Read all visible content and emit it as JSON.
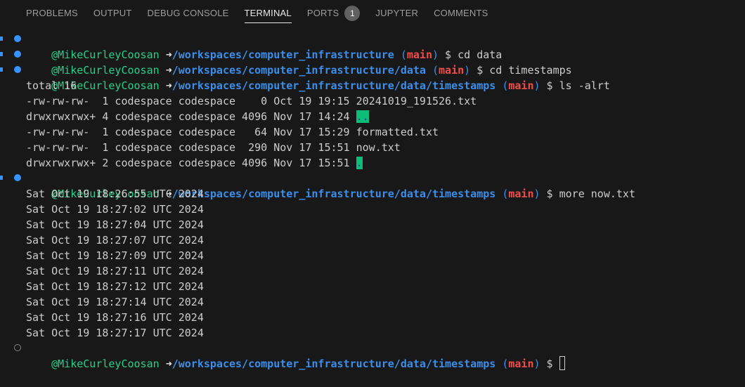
{
  "panel": {
    "tabs": [
      {
        "label": "PROBLEMS"
      },
      {
        "label": "OUTPUT"
      },
      {
        "label": "DEBUG CONSOLE"
      },
      {
        "label": "TERMINAL"
      },
      {
        "label": "PORTS",
        "badge": "1"
      },
      {
        "label": "JUPYTER"
      },
      {
        "label": "COMMENTS"
      }
    ],
    "active_tab": "TERMINAL"
  },
  "terminal": {
    "user": "@MikeCurleyCoosan",
    "arrow": "➜",
    "branch": "main",
    "prompts": [
      {
        "path": "/workspaces/computer_infrastructure",
        "command": "cd data"
      },
      {
        "path": "/workspaces/computer_infrastructure/data",
        "command": "cd timestamps"
      },
      {
        "path": "/workspaces/computer_infrastructure/data/timestamps",
        "command": "ls -alrt"
      },
      {
        "path": "/workspaces/computer_infrastructure/data/timestamps",
        "command": "more now.txt"
      },
      {
        "path": "/workspaces/computer_infrastructure/data/timestamps",
        "command": ""
      }
    ],
    "ls_output": {
      "total": "total 16",
      "rows": [
        {
          "meta": "-rw-rw-rw-  1 codespace codespace    0 Oct 19 19:15",
          "name": "20241019_191526.txt",
          "dir": false
        },
        {
          "meta": "drwxrwxrwx+ 4 codespace codespace 4096 Nov 17 14:24",
          "name": "..",
          "dir": true
        },
        {
          "meta": "-rw-rw-rw-  1 codespace codespace   64 Nov 17 15:29",
          "name": "formatted.txt",
          "dir": false
        },
        {
          "meta": "-rw-rw-rw-  1 codespace codespace  290 Nov 17 15:51",
          "name": "now.txt",
          "dir": false
        },
        {
          "meta": "drwxrwxrwx+ 2 codespace codespace 4096 Nov 17 15:51",
          "name": ".",
          "dir": true
        }
      ]
    },
    "more_output": [
      "Sat Oct 19 18:26:55 UTC 2024",
      "Sat Oct 19 18:27:02 UTC 2024",
      "Sat Oct 19 18:27:04 UTC 2024",
      "Sat Oct 19 18:27:07 UTC 2024",
      "Sat Oct 19 18:27:09 UTC 2024",
      "Sat Oct 19 18:27:11 UTC 2024",
      "Sat Oct 19 18:27:12 UTC 2024",
      "Sat Oct 19 18:27:14 UTC 2024",
      "Sat Oct 19 18:27:16 UTC 2024",
      "Sat Oct 19 18:27:17 UTC 2024"
    ]
  },
  "colors": {
    "background": "#181818",
    "user": "#23d18b",
    "path": "#3b8eea",
    "branch": "#f14c4c",
    "dir_highlight": "#0dbc79",
    "decoration_success": "#3794ff"
  }
}
